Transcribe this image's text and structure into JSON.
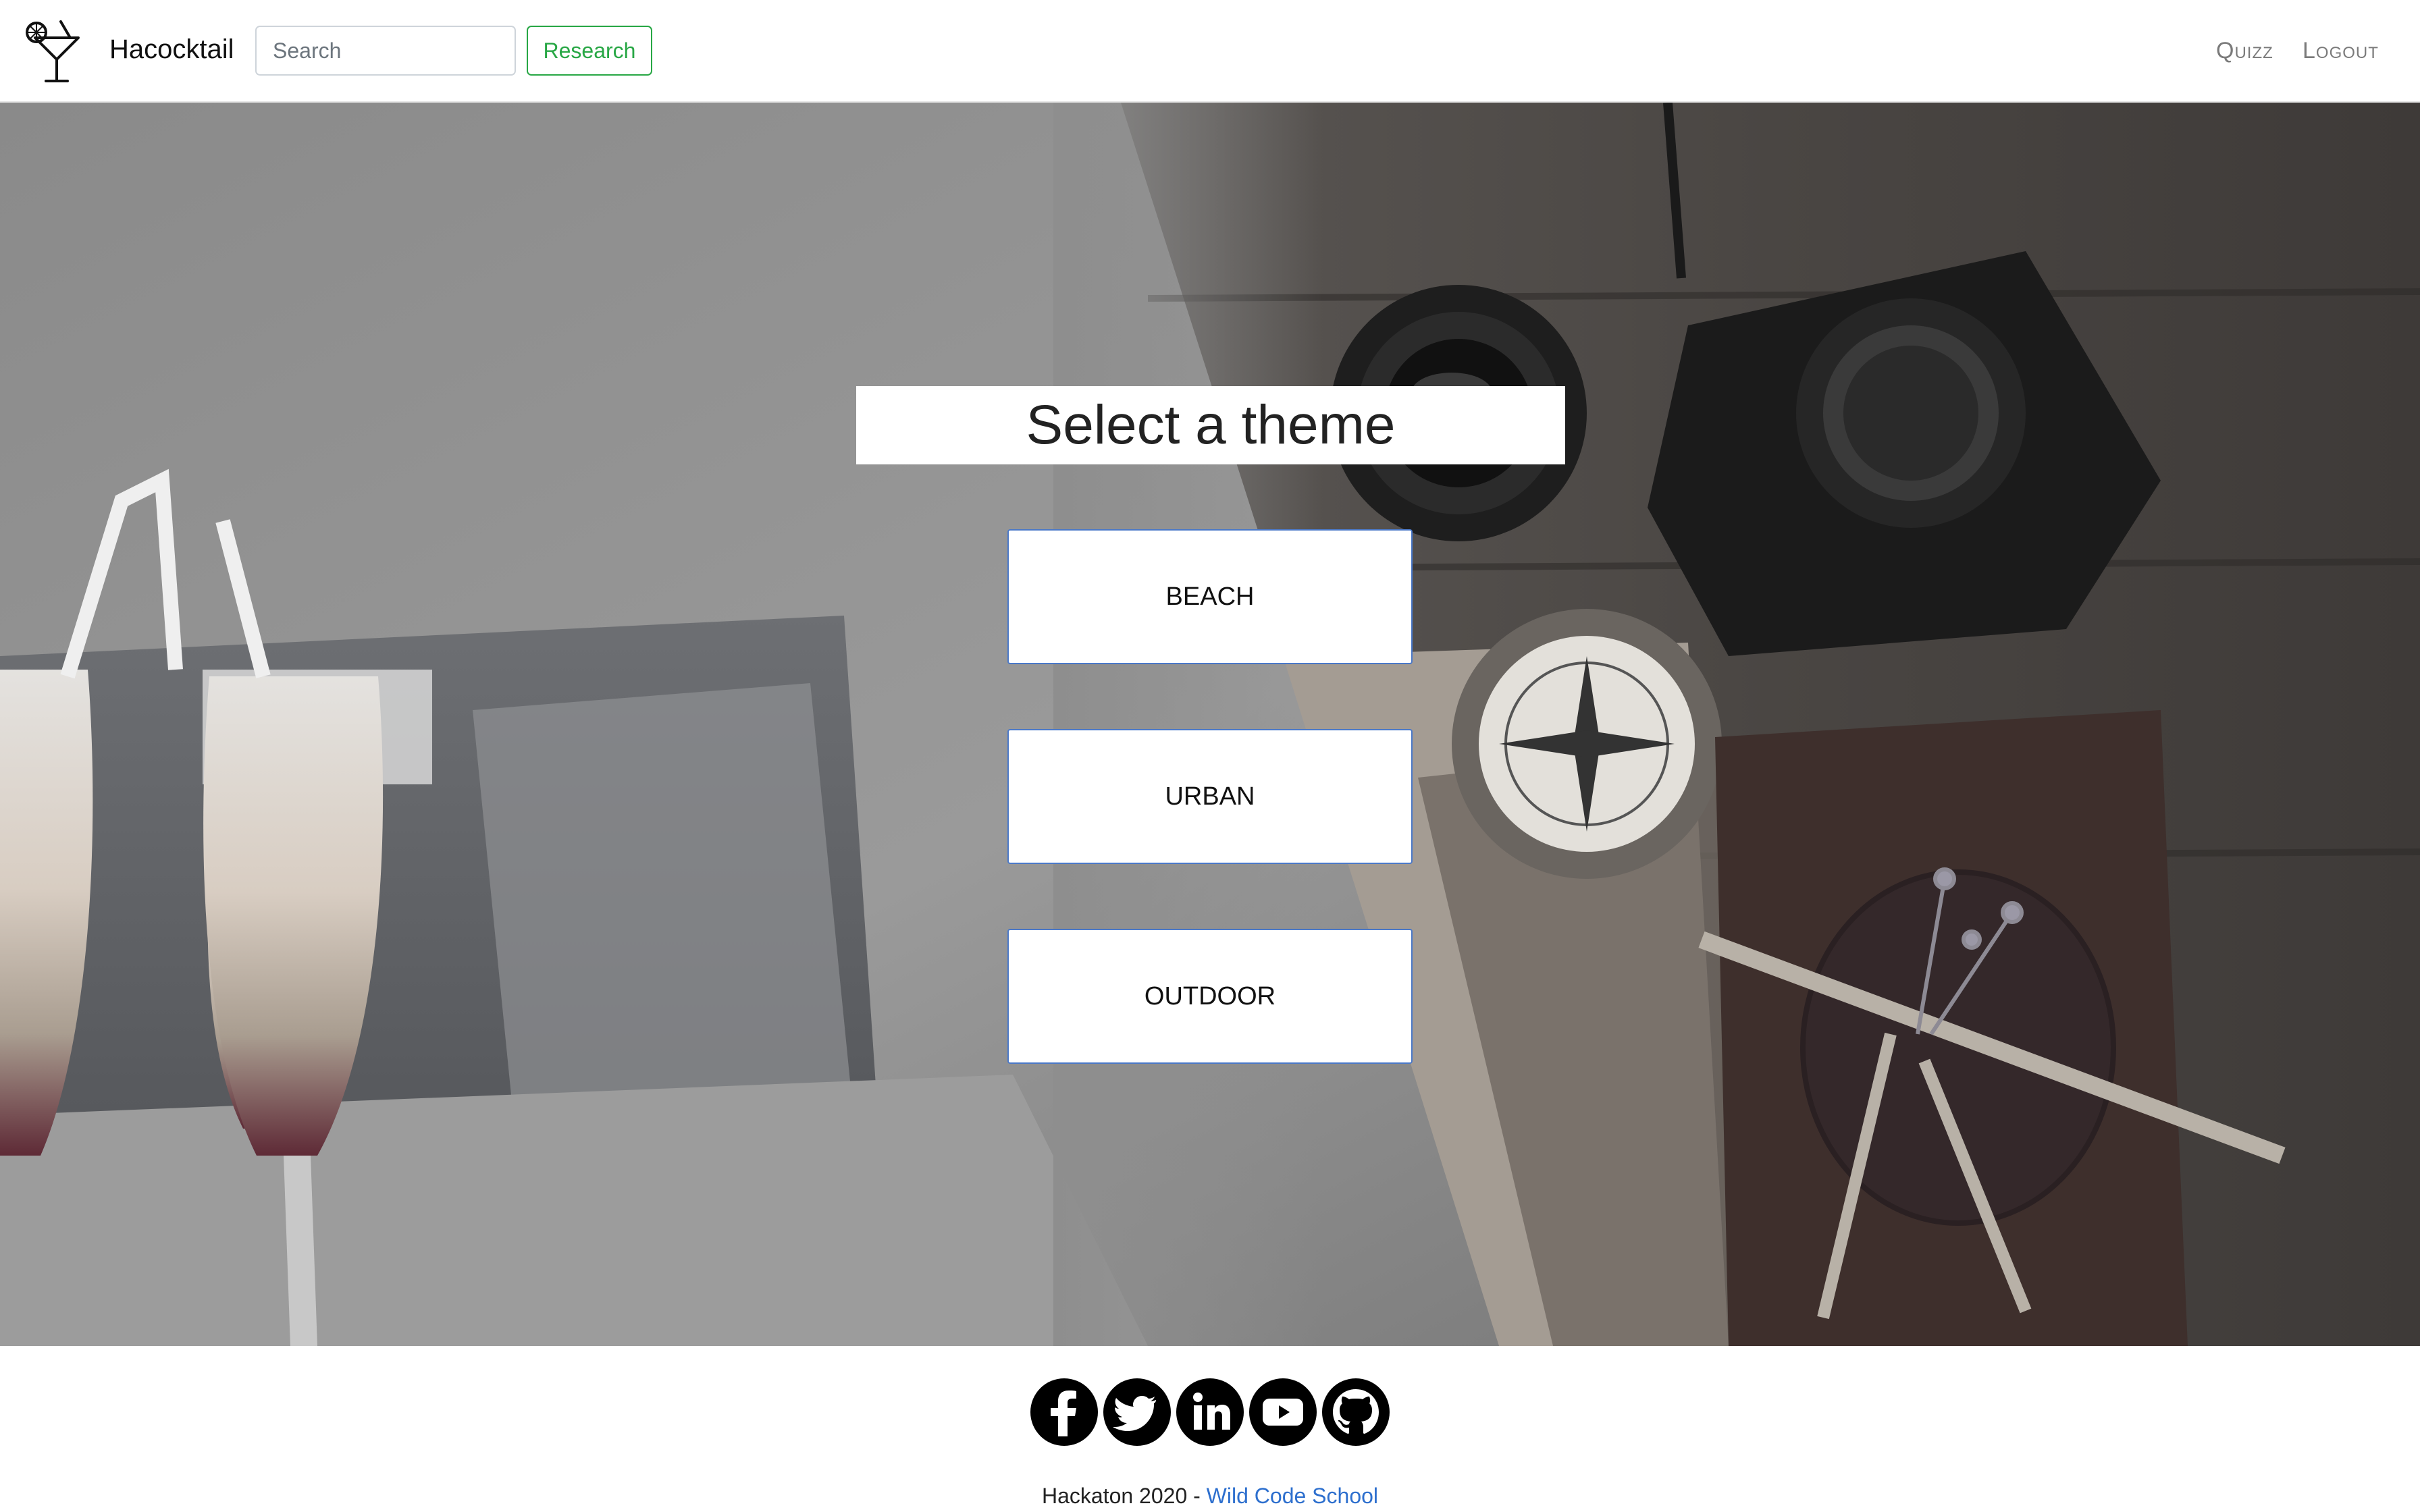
{
  "navbar": {
    "brand_name": "Hacocktail",
    "brand_icon": "cocktail-glass-icon",
    "search_placeholder": "Search",
    "search_button": "Research",
    "links": {
      "quizz": "Quizz",
      "logout": "Logout"
    },
    "link_color": "#7a7a7a",
    "accent_color": "#28a745"
  },
  "main": {
    "title": "Select a theme",
    "themes": [
      "BEACH",
      "URBAN",
      "OUTDOOR"
    ],
    "button_border_color": "#4a78c8"
  },
  "footer": {
    "social_icons": [
      "facebook-icon",
      "twitter-icon",
      "linkedin-icon",
      "youtube-icon",
      "github-icon"
    ],
    "copyright_prefix": "Hackaton 2020 - ",
    "copyright_link": "Wild Code School",
    "link_color": "#2d6fce"
  }
}
